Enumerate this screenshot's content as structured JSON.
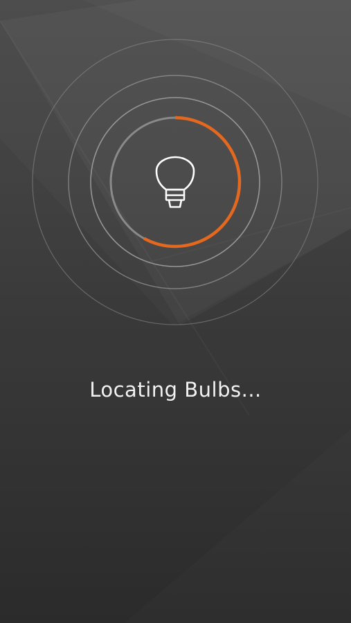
{
  "status": {
    "label": "Locating Bulbs..."
  },
  "progress": {
    "fraction": 0.58,
    "accent_color": "#e5681f",
    "track_color": "#8a8a8a"
  },
  "icon": {
    "name": "lightbulb-icon"
  },
  "colors": {
    "background_top": "#4d4d4d",
    "background_bottom": "#2e2e2e",
    "ring_color": "#9a9a9a"
  }
}
